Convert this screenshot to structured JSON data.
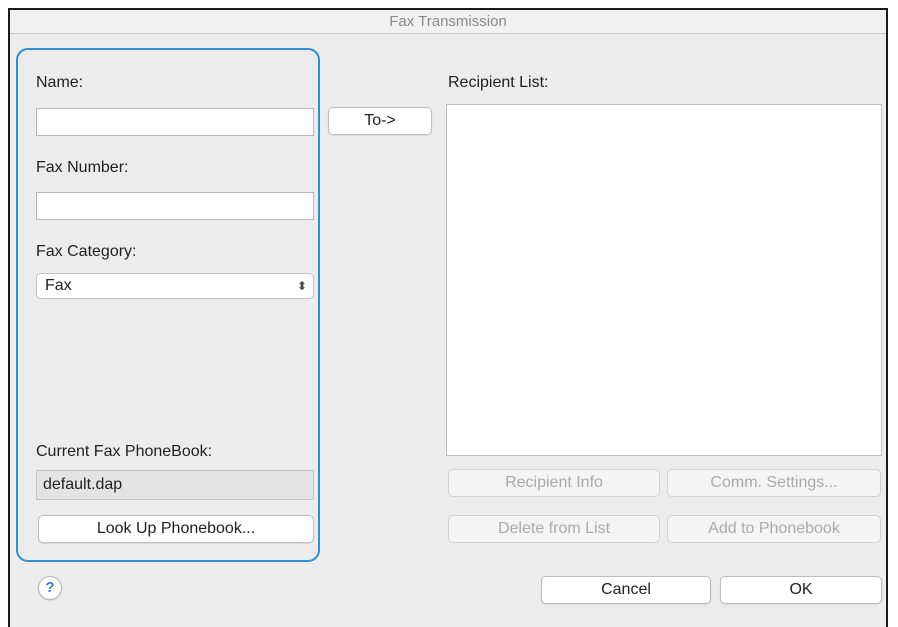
{
  "window": {
    "title": "Fax Transmission"
  },
  "left_panel": {
    "name_label": "Name:",
    "name_value": "",
    "fax_number_label": "Fax Number:",
    "fax_number_value": "",
    "fax_category_label": "Fax Category:",
    "fax_category_selected": "Fax",
    "current_phonebook_label": "Current Fax PhoneBook:",
    "current_phonebook_value": "default.dap",
    "look_up_button": "Look Up Phonebook..."
  },
  "to_button": "To->",
  "recipient_list": {
    "label": "Recipient List:",
    "items": []
  },
  "recipient_buttons": {
    "recipient_info": "Recipient Info",
    "comm_settings": "Comm. Settings...",
    "delete_from_list": "Delete from List",
    "add_to_phonebook": "Add to Phonebook"
  },
  "footer": {
    "help": "?",
    "cancel": "Cancel",
    "ok": "OK"
  },
  "colors": {
    "focus_ring": "#2e8ed8",
    "help_icon": "#2f7fd6"
  }
}
